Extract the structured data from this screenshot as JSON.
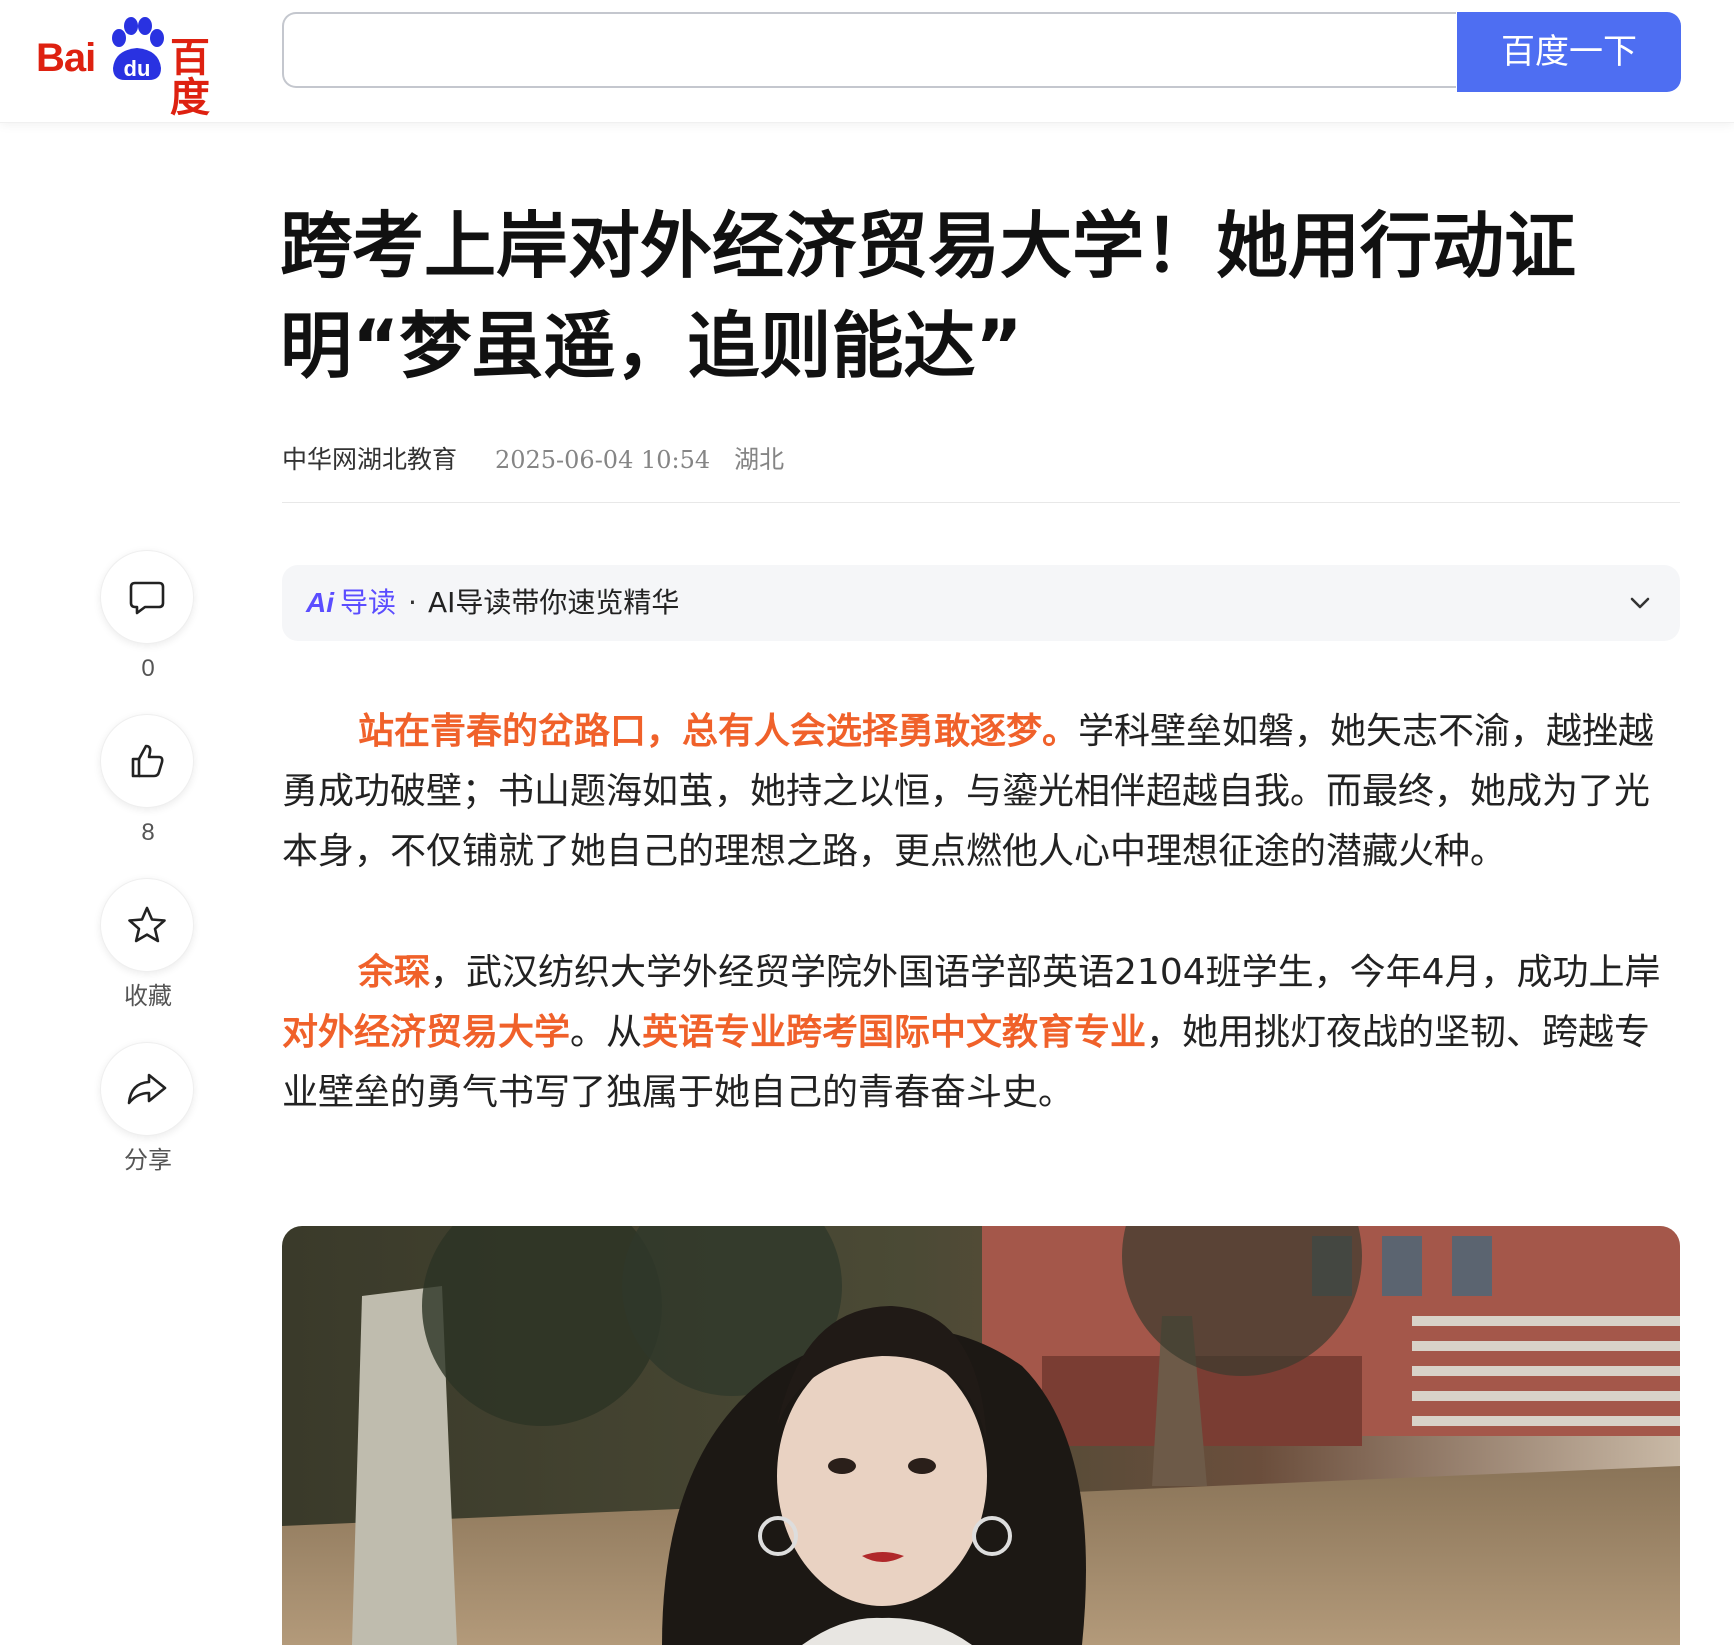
{
  "header": {
    "logo": {
      "text_left": "Bai",
      "text_paw": "du",
      "text_right": "百度"
    },
    "search": {
      "value": "",
      "placeholder": "",
      "button_label": "百度一下"
    }
  },
  "article": {
    "title": "跨考上岸对外经济贸易大学！她用行动证明“梦虽遥，追则能达”",
    "meta": {
      "source": "中华网湖北教育",
      "date": "2025-06-04 10:54",
      "region": "湖北"
    },
    "ai_reader": {
      "logo": "Ai",
      "label": "导读",
      "separator": "·",
      "text": "AI导读带你速览精华"
    },
    "paragraphs": [
      {
        "p1_hl1": "站在青春的岔路口，总有人会选择勇敢逐梦。",
        "p1_t1": "学科壁垒如磐，她矢志不渝，越挫越勇成功破壁；书山题海如茧，她持之以恒，与鎏光相伴超越自我。而最终，她成为了光本身，不仅铺就了她自己的理想之路，更点燃他人心中理想征途的潜藏火种。"
      },
      {
        "p2_hl1": "余琛",
        "p2_t1": "，武汉纺织大学外经贸学院外国语学部英语2104班学生，今年4月，成功上岸",
        "p2_hl2": "对外经济贸易大学",
        "p2_t2": "。从",
        "p2_hl3": "英语专业跨考国际中文教育专业",
        "p2_t3": "，她用挑灯夜战的坚韧、跨越专业壁垒的勇气书写了独属于她自己的青春奋斗史。"
      }
    ]
  },
  "side_actions": [
    {
      "icon": "comment-icon",
      "label": "0"
    },
    {
      "icon": "thumbs-up-icon",
      "label": "8"
    },
    {
      "icon": "star-icon",
      "label": "收藏"
    },
    {
      "icon": "share-icon",
      "label": "分享"
    }
  ],
  "colors": {
    "brand_red": "#de2110",
    "search_blue": "#4e6ef2",
    "highlight_orange": "#f0612a",
    "ai_purple": "#5b4dff"
  }
}
